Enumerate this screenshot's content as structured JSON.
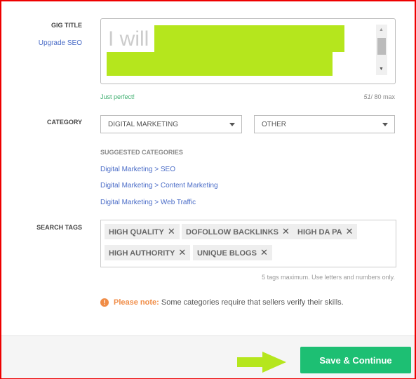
{
  "gig_title": {
    "label": "GIG TITLE",
    "upgrade_link": "Upgrade SEO",
    "value_prefix": "I will",
    "status": "Just perfect!",
    "count": "51",
    "max": "/ 80 max"
  },
  "category": {
    "label": "CATEGORY",
    "primary": "DIGITAL MARKETING",
    "secondary": "OTHER",
    "suggested_heading": "SUGGESTED CATEGORIES",
    "suggested": [
      "Digital Marketing > SEO",
      "Digital Marketing > Content Marketing",
      "Digital Marketing > Web Traffic"
    ]
  },
  "tags": {
    "label": "SEARCH TAGS",
    "items": [
      "HIGH QUALITY",
      "DOFOLLOW BACKLINKS",
      "HIGH DA PA",
      "HIGH AUTHORITY",
      "UNIQUE BLOGS"
    ],
    "hint": "5 tags maximum. Use letters and numbers only.",
    "remove_glyph": "✕"
  },
  "note": {
    "label": "Please note:",
    "text": "Some categories require that sellers verify their skills.",
    "icon": "info-icon"
  },
  "footer": {
    "save_label": "Save & Continue"
  },
  "colors": {
    "accent": "#1dbf73",
    "link": "#4a6cc7",
    "warning": "#f08c46",
    "redaction": "#b5e61d",
    "frame": "#ee0000"
  }
}
